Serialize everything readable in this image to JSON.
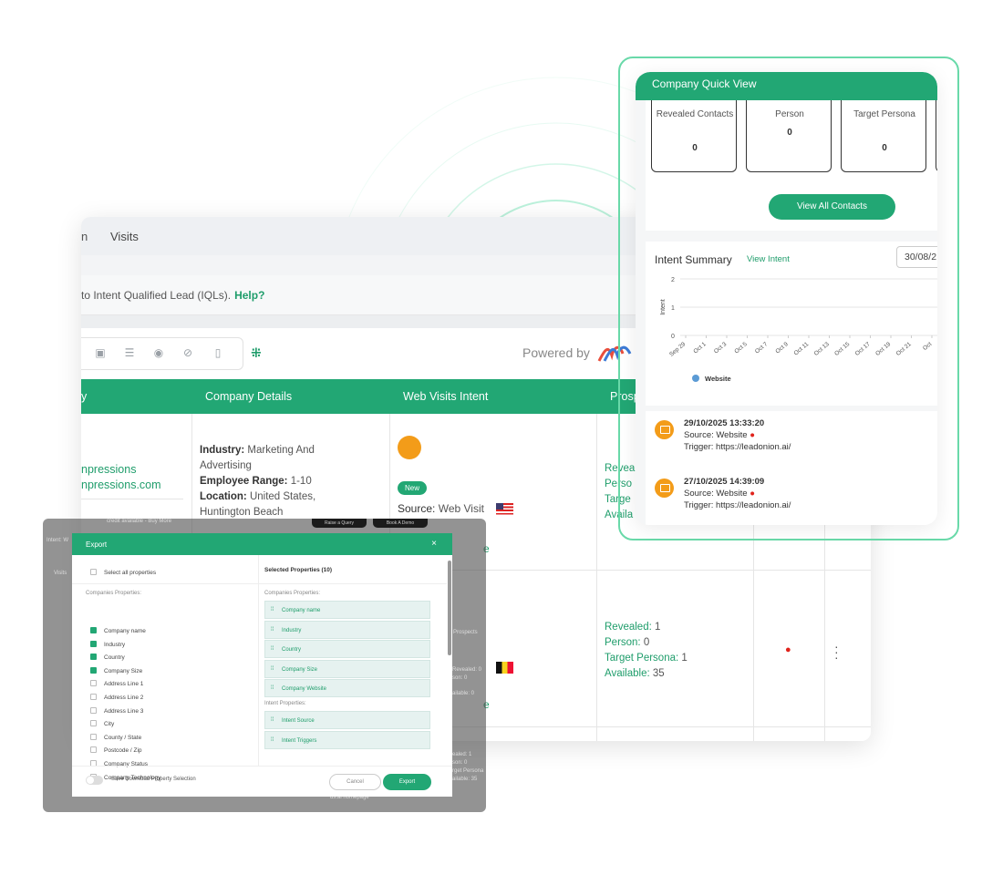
{
  "main": {
    "nav": {
      "left_fragment": "n",
      "visits_tab": "Visits"
    },
    "info": {
      "text": "to Intent Qualified Lead (IQLs).",
      "help": "Help?"
    },
    "powered_by": "Powered by",
    "table_headers": {
      "col1": "y",
      "col2": "Company Details",
      "col3": "Web Visits Intent",
      "col4": "Prosp"
    },
    "row1": {
      "company_name_1": "npressions",
      "company_name_2": "npressions.com",
      "industry_label": "Industry:",
      "industry_value": "Marketing And Advertising",
      "employee_label": "Employee Range:",
      "employee_value": "1-10",
      "location_label": "Location:",
      "location_value": "United States, Huntington Beach",
      "badge": "New",
      "source_label": "Source:",
      "source_value": "Web Visit",
      "prospect_revealed": "Reveal",
      "prospect_person": "Perso",
      "prospect_target": "Targe",
      "prospect_available": "Availa"
    },
    "row2": {
      "revealed_label": "Revealed:",
      "revealed_value": "1",
      "person_label": "Person:",
      "person_value": "0",
      "target_label": "Target Persona:",
      "target_value": "1",
      "available_label": "Available:",
      "available_value": "35"
    },
    "partial": {
      "e1": "e",
      "e2": "e",
      "raise_query": "Raise a Query",
      "book_demo": "Book A Demo"
    }
  },
  "export_modal": {
    "title": "Export",
    "close": "×",
    "select_all": "Select all properties",
    "companies_properties_label": "Companies Properties:",
    "properties": [
      {
        "label": "Company name",
        "checked": true
      },
      {
        "label": "Industry",
        "checked": true
      },
      {
        "label": "Country",
        "checked": true
      },
      {
        "label": "Company Size",
        "checked": true
      },
      {
        "label": "Address Line 1",
        "checked": false
      },
      {
        "label": "Address Line 2",
        "checked": false
      },
      {
        "label": "Address Line 3",
        "checked": false
      },
      {
        "label": "City",
        "checked": false
      },
      {
        "label": "County / State",
        "checked": false
      },
      {
        "label": "Postcode / Zip",
        "checked": false
      },
      {
        "label": "Company Status",
        "checked": false
      },
      {
        "label": "Company Technology",
        "checked": false
      }
    ],
    "selected_title": "Selected Properties (10)",
    "selected_companies_label": "Companies Properties:",
    "selected_companies": [
      "Company name",
      "Industry",
      "Country",
      "Company Size",
      "Company Website"
    ],
    "intent_properties_label": "Intent Properties:",
    "selected_intent": [
      "Intent Source",
      "Intent Triggers"
    ],
    "save_selection": "Save Download Property Selection",
    "cancel": "Cancel",
    "export": "Export",
    "background": {
      "credits": "credit available - Buy More",
      "intent": "Intent: W",
      "visits": "Visits",
      "prospects": "Prospects",
      "revealed": "Revealed: 0",
      "person": "son: 0",
      "available": "ailable: 0",
      "revealed2": "ealed: 1",
      "person2": "son: 0",
      "target2": "rget Persona",
      "available2": "ailable: 35",
      "homepage": "ds.ai homepage"
    }
  },
  "quick_view": {
    "title": "Company Quick View",
    "stats": [
      {
        "label": "Revealed Contacts",
        "value": "0"
      },
      {
        "label": "Person",
        "value": "0"
      },
      {
        "label": "Target Persona",
        "value": "0"
      }
    ],
    "view_all_button": "View All Contacts",
    "intent_summary": {
      "title": "Intent Summary",
      "view_link": "View Intent",
      "date": "30/08/2"
    },
    "activities": [
      {
        "timestamp": "29/10/2025 13:33:20",
        "source_label": "Source:",
        "source": "Website",
        "trigger_label": "Trigger:",
        "trigger": "https://leadonion.ai/"
      },
      {
        "timestamp": "27/10/2025 14:39:09",
        "source_label": "Source:",
        "source": "Website",
        "trigger_label": "Trigger:",
        "trigger": "https://leadonion.ai/"
      }
    ]
  },
  "chart_data": {
    "type": "line",
    "title": "",
    "xlabel": "",
    "ylabel": "Intent",
    "ylim": [
      0,
      2
    ],
    "yticks": [
      "0",
      "1",
      "2"
    ],
    "categories": [
      "Sep 29",
      "Oct 1",
      "Oct 3",
      "Oct 5",
      "Oct 7",
      "Oct 9",
      "Oct 11",
      "Oct 13",
      "Oct 15",
      "Oct 17",
      "Oct 19",
      "Oct 21",
      "Oct"
    ],
    "series": [
      {
        "name": "Website",
        "values": []
      }
    ],
    "legend": "bottom-left",
    "grid": true,
    "color": "#5b9bd5"
  },
  "colors": {
    "brand_green": "#22a774",
    "accent_orange": "#f39c19",
    "fire_red": "#e0231b",
    "highlight_frame": "#69d9a9"
  }
}
